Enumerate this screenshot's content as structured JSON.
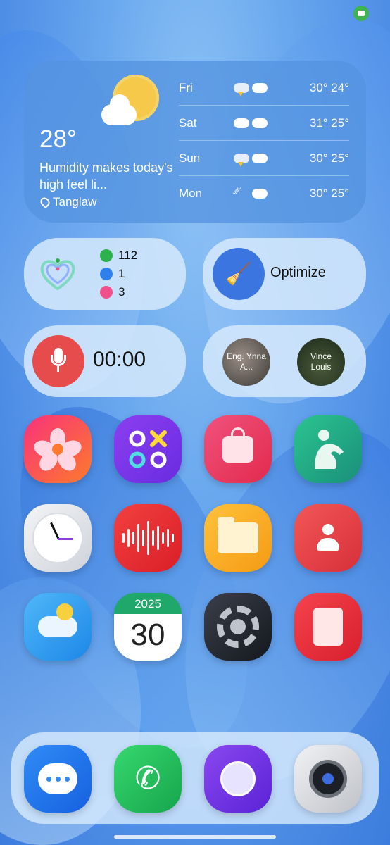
{
  "weather": {
    "current_temp": "28°",
    "description": "Humidity makes today's high feel li...",
    "location": "Tanglaw",
    "forecast": [
      {
        "day": "Fri",
        "temps": "30° 24°",
        "day_icon": "thunderstorm-icon",
        "night_icon": "cloud-icon"
      },
      {
        "day": "Sat",
        "temps": "31° 25°",
        "day_icon": "cloud-icon",
        "night_icon": "cloud-icon"
      },
      {
        "day": "Sun",
        "temps": "30° 25°",
        "day_icon": "thunderstorm-icon",
        "night_icon": "cloud-icon"
      },
      {
        "day": "Mon",
        "temps": "30° 25°",
        "day_icon": "rain-icon",
        "night_icon": "cloud-icon"
      }
    ]
  },
  "health": {
    "steps": "112",
    "active_minutes": "1",
    "calories": "3",
    "colors": {
      "steps": "#2bb24c",
      "active": "#2f80ed",
      "calories": "#f0508c"
    }
  },
  "optimize": {
    "label": "Optimize",
    "icon": "broom-icon"
  },
  "recorder": {
    "timer": "00:00",
    "icon": "microphone-icon"
  },
  "contacts": [
    {
      "name": "Eng. Ynna A..."
    },
    {
      "name": "Vince Louis"
    }
  ],
  "apps": {
    "row1": [
      "gallery-icon",
      "game-launcher-icon",
      "galaxy-store-icon",
      "samsung-health-icon"
    ],
    "row2": [
      "clock-icon",
      "voice-recorder-icon",
      "my-files-icon",
      "contacts-icon"
    ],
    "row3": [
      "weather-icon",
      "calendar-icon",
      "settings-icon",
      "notes-icon"
    ],
    "calendar_year": "2025",
    "calendar_day": "30"
  },
  "dock": [
    "messages-icon",
    "phone-icon",
    "internet-icon",
    "camera-icon"
  ],
  "colors": {
    "accent": "#3a75e0",
    "recorder": "#e64c4c"
  }
}
